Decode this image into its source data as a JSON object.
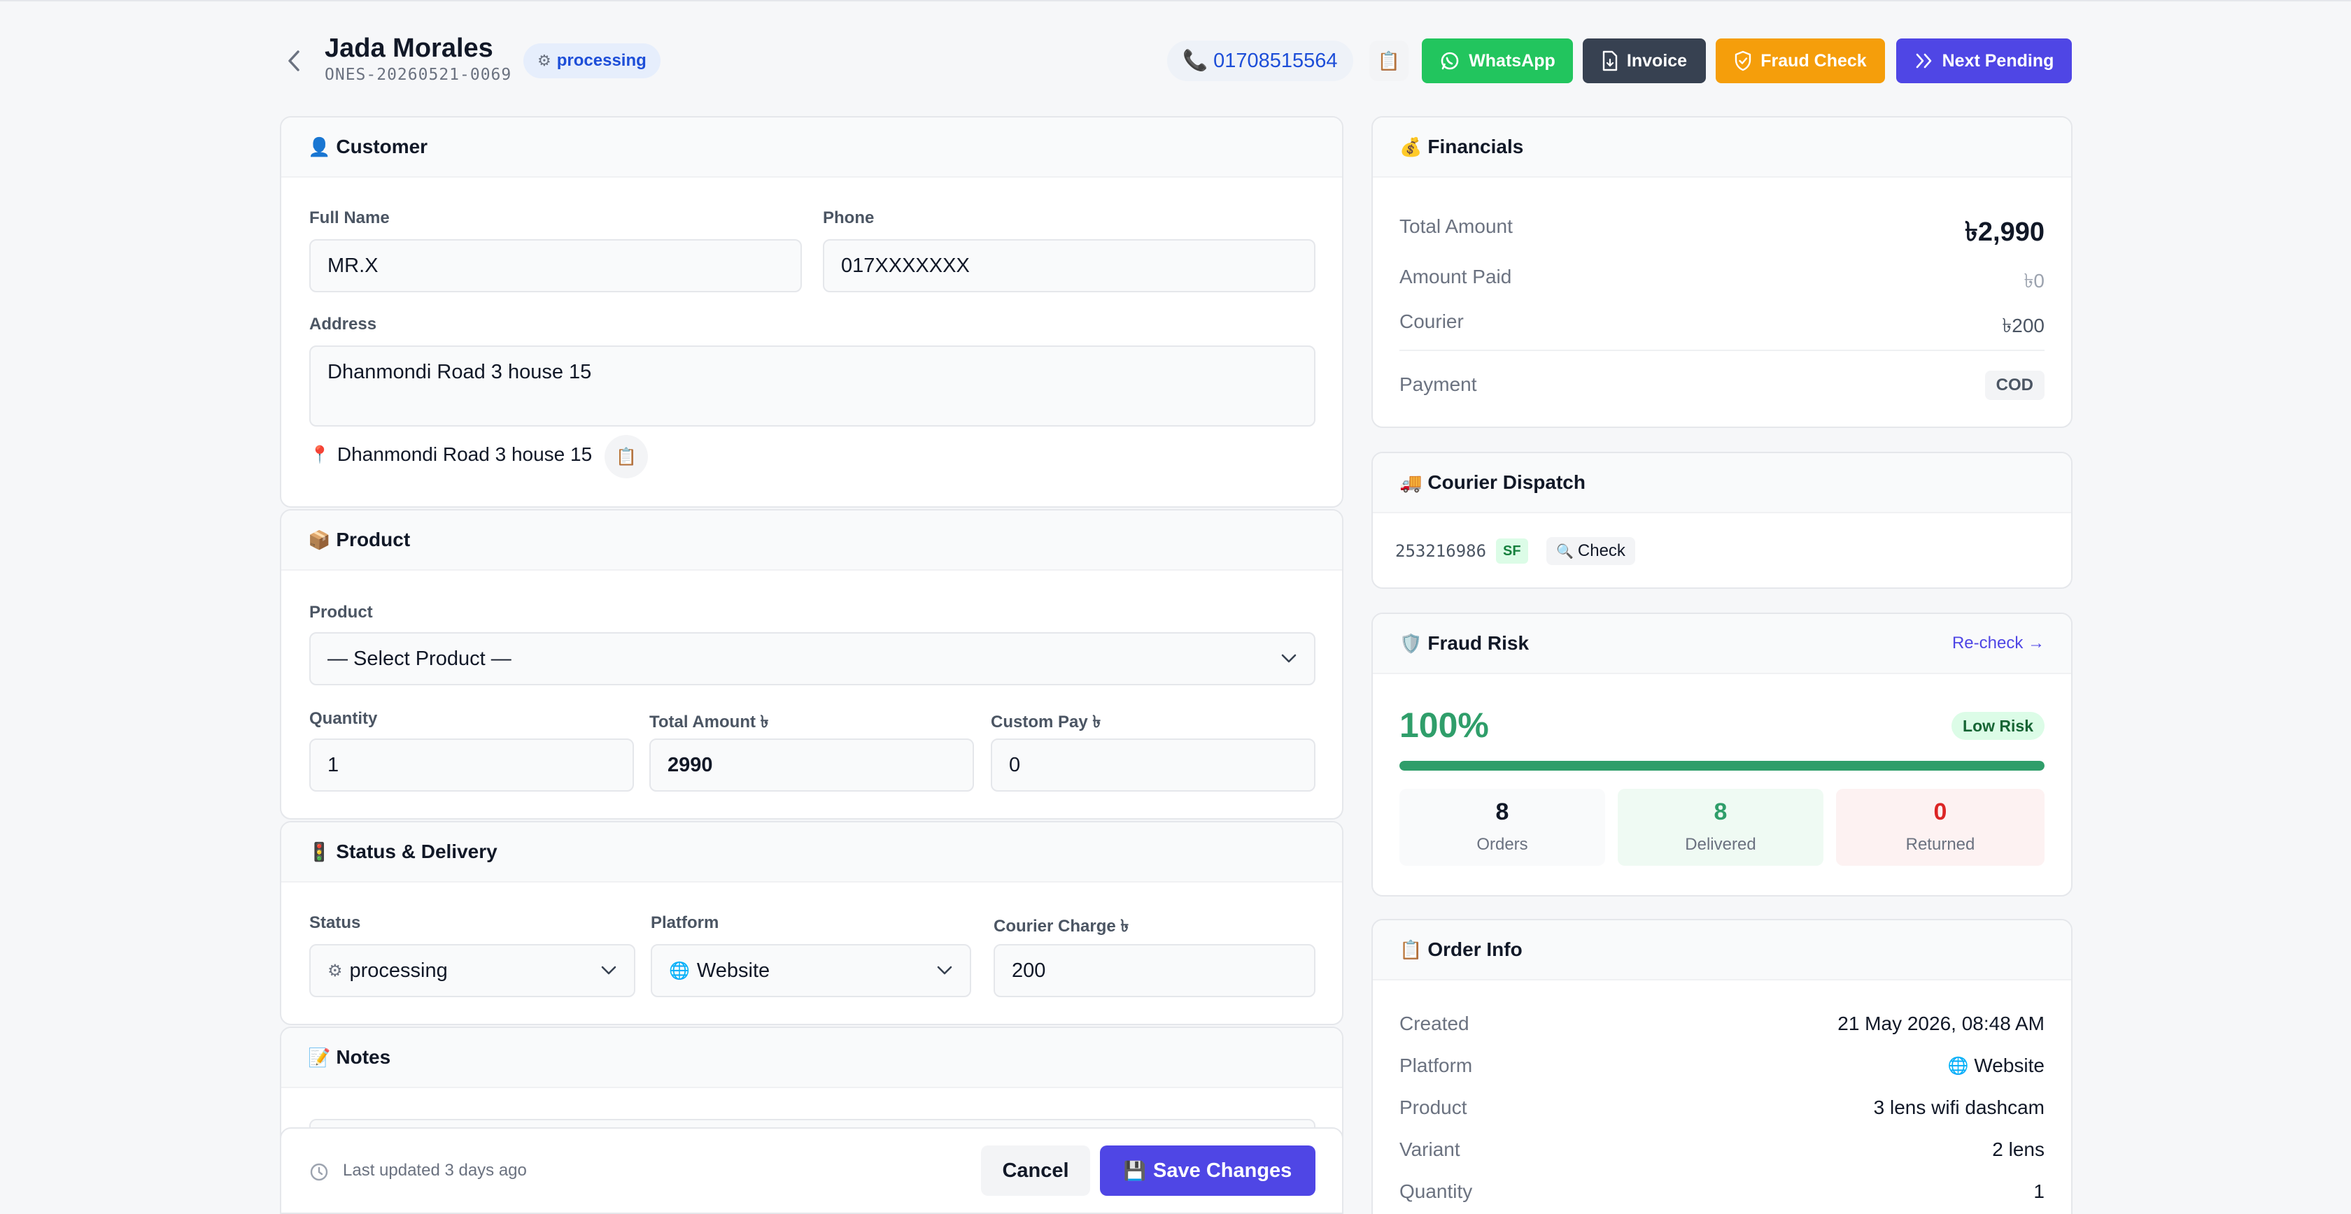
{
  "header": {
    "customer_name": "Jada Morales",
    "order_number": "ONES-20260521-0069",
    "status": "processing",
    "phone": "01708515564",
    "buttons": {
      "whatsapp": "WhatsApp",
      "invoice": "Invoice",
      "fraud_check": "Fraud Check",
      "next_pending": "Next Pending"
    }
  },
  "customer": {
    "title": "Customer",
    "full_name_label": "Full Name",
    "full_name": "MR.X",
    "phone_label": "Phone",
    "phone": "017XXXXXXX",
    "address_label": "Address",
    "address": "Dhanmondi Road 3 house 15",
    "location_line": "Dhanmondi Road 3 house 15"
  },
  "product": {
    "title": "Product",
    "product_label": "Product",
    "product_placeholder": "— Select Product —",
    "quantity_label": "Quantity",
    "quantity": "1",
    "total_amount_label": "Total Amount ৳",
    "total_amount": "2990",
    "custom_pay_label": "Custom Pay ৳",
    "custom_pay": "0"
  },
  "status_delivery": {
    "title": "Status & Delivery",
    "status_label": "Status",
    "status": "processing",
    "platform_label": "Platform",
    "platform": "Website",
    "courier_charge_label": "Courier Charge ৳",
    "courier_charge": "200"
  },
  "notes": {
    "title": "Notes"
  },
  "footer": {
    "last_updated": "Last updated 3 days ago",
    "cancel": "Cancel",
    "save": "Save Changes"
  },
  "financials": {
    "title": "Financials",
    "total_amount_label": "Total Amount",
    "total_amount": "৳2,990",
    "amount_paid_label": "Amount Paid",
    "amount_paid": "৳0",
    "courier_label": "Courier",
    "courier": "৳200",
    "payment_label": "Payment",
    "payment": "COD"
  },
  "courier_dispatch": {
    "title": "Courier Dispatch",
    "tracking_id": "253216986",
    "carrier_badge": "SF",
    "check_label": "Check"
  },
  "fraud_risk": {
    "title": "Fraud Risk",
    "recheck": "Re-check →",
    "percent": "100%",
    "success_ratio": 1.0,
    "risk_badge": "Low Risk",
    "orders": "8",
    "orders_label": "Orders",
    "delivered": "8",
    "delivered_label": "Delivered",
    "returned": "0",
    "returned_label": "Returned"
  },
  "order_info": {
    "title": "Order Info",
    "created_label": "Created",
    "created": "21 May 2026, 08:48 AM",
    "platform_label": "Platform",
    "platform": "Website",
    "product_label": "Product",
    "product": "3 lens wifi dashcam",
    "variant_label": "Variant",
    "variant": "2 lens",
    "quantity_label": "Quantity",
    "quantity": "1"
  },
  "colors": {
    "accent": "#4f46e5",
    "whatsapp": "#22c55e",
    "invoice": "#374151",
    "fraud": "#f59e0b",
    "success": "#2f9e6a",
    "danger": "#dc2626"
  }
}
